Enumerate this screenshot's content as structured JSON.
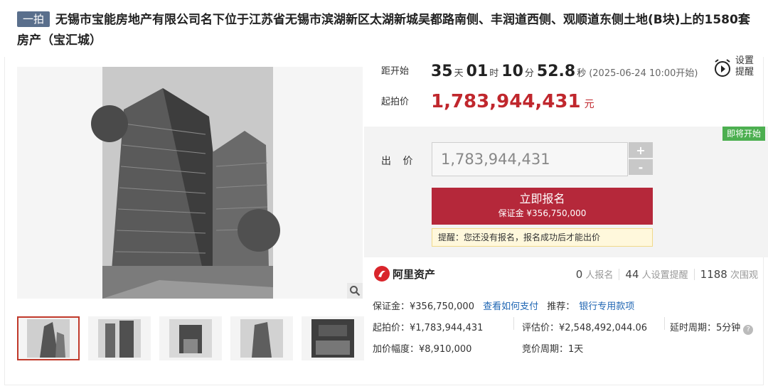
{
  "header": {
    "round_tag": "一拍",
    "title": "无锡市宝能房地产有限公司名下位于江苏省无锡市滨湖新区太湖新城吴都路南侧、丰润道西侧、观顺道东侧土地(B块)上的1580套房产（宝汇城）"
  },
  "gallery": {
    "zoom_icon": "magnifier-icon",
    "thumb_count": 5
  },
  "countdown": {
    "label": "距开始",
    "days": "35",
    "days_unit": "天",
    "hours": "01",
    "hours_unit": "时",
    "minutes": "10",
    "minutes_unit": "分",
    "seconds": "52.8",
    "seconds_unit": "秒",
    "note": "(2025-06-24 10:00开始)"
  },
  "reminder": {
    "line1": "设置",
    "line2": "提醒",
    "icon": "alarm-clock-icon"
  },
  "start_price": {
    "label": "起拍价",
    "value": "1,783,944,431",
    "unit": "元"
  },
  "bid": {
    "status_badge": "即将开始",
    "label": "出 价",
    "input_value": "1,783,944,431",
    "plus": "+",
    "minus": "-",
    "signup_label": "立即报名",
    "signup_deposit": "保证金 ¥356,750,000",
    "notice": "提醒：您还没有报名，报名成功后才能出价"
  },
  "seller": {
    "name": "阿里资产",
    "signups_num": "0",
    "signups_label": "人报名",
    "reminders_num": "44",
    "reminders_label": "人设置提醒",
    "views_num": "1188",
    "views_label": "次围观"
  },
  "details": {
    "deposit": "保证金：¥356,750,000",
    "how_to_pay": "查看如何支付",
    "recommend_label": "推荐：",
    "bank_link": "银行专用款项",
    "start_price": "起拍价：¥1,783,944,431",
    "appraisal": "评估价：¥2,548,492,044.06",
    "delay": "延时周期：5分钟",
    "increment": "加价幅度：¥8,910,000",
    "bid_cycle": "竞价周期：1天"
  },
  "colors": {
    "accent": "#c0272d",
    "signup": "#b5283a",
    "badge": "#4caf50",
    "link": "#1f66b3",
    "tag": "#5a6f8c"
  }
}
